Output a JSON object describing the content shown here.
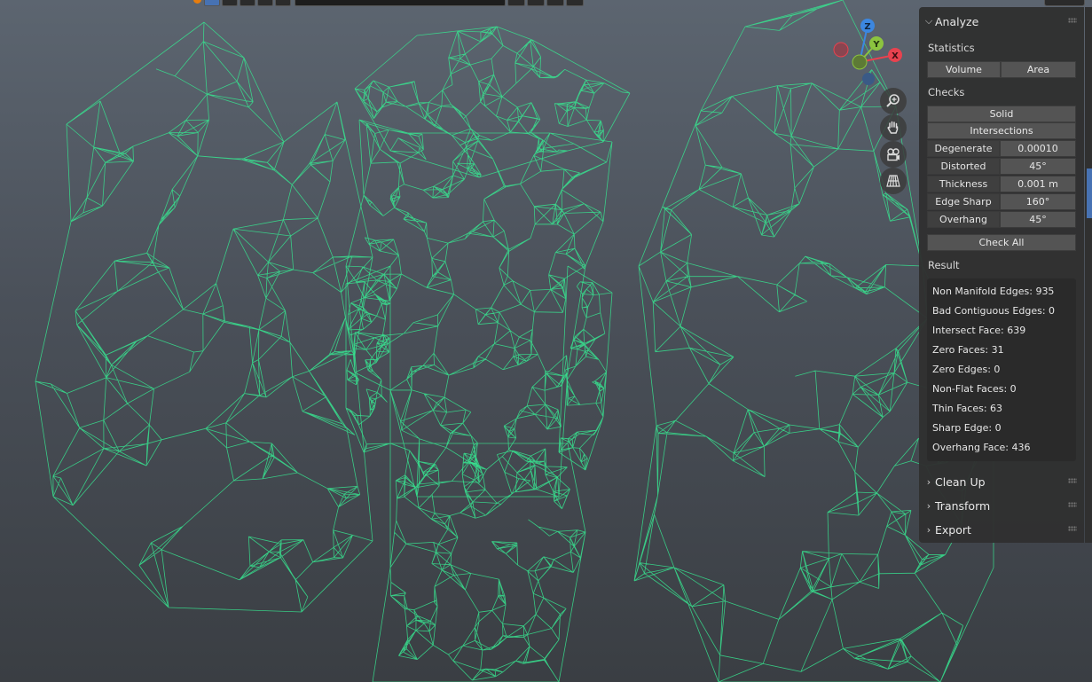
{
  "analyze": {
    "title": "Analyze",
    "statistics_label": "Statistics",
    "volume_btn": "Volume",
    "area_btn": "Area",
    "checks_label": "Checks",
    "solid_btn": "Solid",
    "intersections_btn": "Intersections",
    "checks": [
      {
        "label": "Degenerate",
        "value": "0.00010"
      },
      {
        "label": "Distorted",
        "value": "45°"
      },
      {
        "label": "Thickness",
        "value": "0.001 m"
      },
      {
        "label": "Edge Sharp",
        "value": "160°"
      },
      {
        "label": "Overhang",
        "value": "45°"
      }
    ],
    "check_all_btn": "Check All",
    "result_label": "Result",
    "results": [
      "Non Manifold Edges: 935",
      "Bad Contiguous Edges: 0",
      "Intersect Face: 639",
      "Zero Faces: 31",
      "Zero Edges: 0",
      "Non-Flat Faces: 0",
      "Thin Faces: 63",
      "Sharp Edge: 0",
      "Overhang Face: 436"
    ]
  },
  "panels": {
    "clean_up": "Clean Up",
    "transform": "Transform",
    "export": "Export"
  },
  "gizmo": {
    "x": "X",
    "y": "Y",
    "z": "Z"
  },
  "icons": {
    "zoom": "zoom-icon",
    "pan": "hand-icon",
    "camera": "camera-icon",
    "ortho": "grid-icon"
  },
  "colors": {
    "wire": "#37e38f",
    "x_axis": "#e8424f",
    "y_axis": "#8cc43f",
    "z_axis": "#3c87e0"
  }
}
